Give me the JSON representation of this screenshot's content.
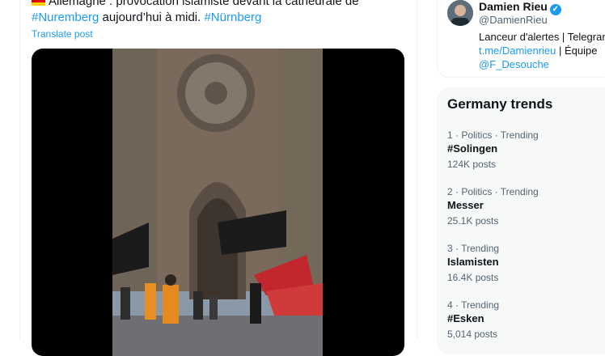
{
  "tweet": {
    "text_part1": "Allemagne : provocation islamiste devant la cathédrale de",
    "hashtag1": "#Nuremberg",
    "text_part2": "aujourd’hui à midi.",
    "hashtag2": "#Nürnberg",
    "translate_label": "Translate post",
    "flag_colors": [
      "#000000",
      "#dd0000",
      "#ffce00"
    ]
  },
  "profile": {
    "name": "Damien Rieu",
    "verified_icon": "verified-badge-icon",
    "handle": "@DamienRieu",
    "bio_line1": "Lanceur d'alertes | Telegram",
    "bio_link": "t.me/Damienrieu",
    "bio_line2_suffix": "| Équipe",
    "bio_mention": "@F_Desouche"
  },
  "trends": {
    "title": "Germany trends",
    "items": [
      {
        "meta": "1 · Politics · Trending",
        "name": "#Solingen",
        "posts": "124K posts"
      },
      {
        "meta": "2 · Politics · Trending",
        "name": "Messer",
        "posts": "25.1K posts"
      },
      {
        "meta": "3 · Trending",
        "name": "Islamisten",
        "posts": "16.4K posts"
      },
      {
        "meta": "4 · Trending",
        "name": "#Esken",
        "posts": "5,014 posts"
      }
    ]
  },
  "colors": {
    "accent": "#1d9bf0",
    "text": "#0f1419",
    "muted": "#536471"
  }
}
